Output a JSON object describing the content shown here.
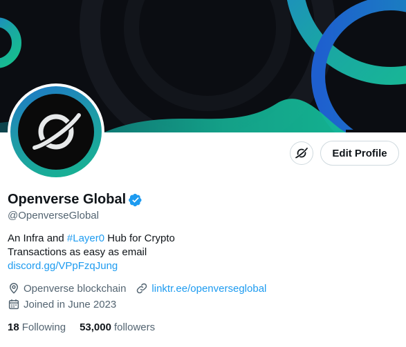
{
  "profile": {
    "display_name": "Openverse Global",
    "handle": "@OpenverseGlobal",
    "bio_prefix": "An Infra and ",
    "bio_hashtag": "#Layer0",
    "bio_suffix": " Hub for Crypto",
    "bio_line2": "Transactions as easy as email",
    "bio_link": "discord.gg/VPpFzqJung",
    "location": "Openverse blockchain",
    "website": "linktr.ee/openverseglobal",
    "joined": "Joined in June 2023",
    "following_count": "18",
    "following_label": "Following",
    "followers_count": "53,000",
    "followers_label": "followers"
  },
  "actions": {
    "edit_profile_label": "Edit Profile"
  },
  "icons": {
    "avatar_logo": "planet-ring-icon",
    "verified": "verified-badge-icon",
    "extra_action": "planet-ring-icon",
    "location": "location-pin-icon",
    "website": "link-icon",
    "joined": "calendar-icon"
  },
  "colors": {
    "accent": "#1d9bf0",
    "banner_bg": "#0b0d12",
    "banner_teal": "#18b48f",
    "banner_blue": "#1f6fd0",
    "secondary_text": "#536471"
  }
}
